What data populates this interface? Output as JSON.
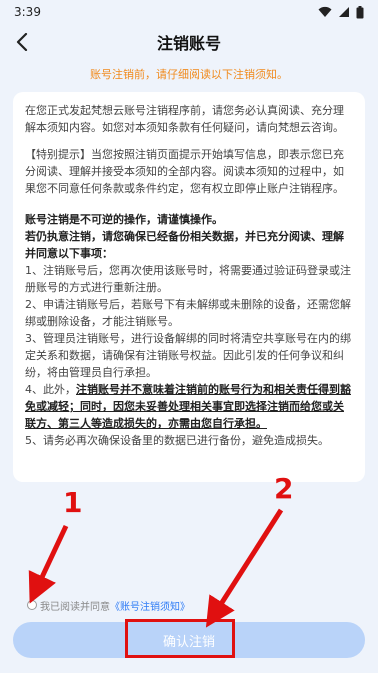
{
  "status": {
    "time": "3:39"
  },
  "header": {
    "title": "注销账号"
  },
  "notice": "账号注销前，请仔细阅读以下注销须知。",
  "card": {
    "intro": "在您正式发起梵想云账号注销程序前，请您务必认真阅读、充分理解本须知内容。如您对本须知条款有任何疑问，请向梵想云咨询。",
    "tip": "【特别提示】当您按照注销页面提示开始填写信息，即表示您已充分阅读、理解并接受本须知的全部内容。阅读本须知的过程中，如果您不同意任何条款或条件约定，您有权立即停止账户注销程序。",
    "warning": "账号注销是不可逆的操作，请谨慎操作。",
    "insist": "若仍执意注销，请您确保已经备份相关数据，并已充分阅读、理解并同意以下事项：",
    "item1": "1、注销账号后，您再次使用该账号时，将需要通过验证码登录或注册账号的方式进行重新注册。",
    "item2": "2、申请注销账号后，若账号下有未解绑或未删除的设备，还需您解绑或删除设备，才能注销账号。",
    "item3": "3、管理员注销账号，进行设备解绑的同时将清空共享账号在内的绑定关系和数据，请确保有注销账号权益。因此引发的任何争议和纠纷，将由管理员自行承担。",
    "item4_prefix": "4、此外，",
    "item4_underlined": "注销账号并不意味着注销前的账号行为和相关责任得到豁免或减轻；同时，因您未妥善处理相关事宜即选择注销而给您或关联方、第三人等造成损失的，亦需由您自行承担。",
    "item5": "5、请务必再次确保设备里的数据已进行备份，避免造成损失。"
  },
  "agreement": {
    "prefix": "我已阅读并同意",
    "link": "《账号注销须知》"
  },
  "confirm_button": "确认注销",
  "annotations": {
    "label1": "1",
    "label2": "2",
    "color": "#e01010"
  }
}
